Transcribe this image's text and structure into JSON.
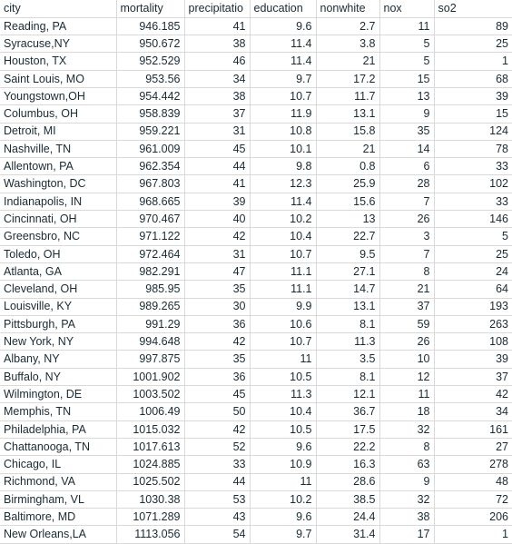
{
  "table": {
    "columns": [
      {
        "key": "city",
        "label": "city",
        "align": "left"
      },
      {
        "key": "mortality",
        "label": "mortality",
        "align": "right"
      },
      {
        "key": "precipitation",
        "label": "precipitatio",
        "align": "right"
      },
      {
        "key": "education",
        "label": "education",
        "align": "right"
      },
      {
        "key": "nonwhite",
        "label": "nonwhite",
        "align": "right"
      },
      {
        "key": "nox",
        "label": "nox",
        "align": "right"
      },
      {
        "key": "so2",
        "label": "so2",
        "align": "right"
      }
    ],
    "rows": [
      {
        "city": "Reading, PA",
        "mortality": "946.185",
        "precipitation": "41",
        "education": "9.6",
        "nonwhite": "2.7",
        "nox": "11",
        "so2": "89"
      },
      {
        "city": "Syracuse,NY",
        "mortality": "950.672",
        "precipitation": "38",
        "education": "11.4",
        "nonwhite": "3.8",
        "nox": "5",
        "so2": "25"
      },
      {
        "city": "Houston, TX",
        "mortality": "952.529",
        "precipitation": "46",
        "education": "11.4",
        "nonwhite": "21",
        "nox": "5",
        "so2": "1"
      },
      {
        "city": "Saint Louis, MO",
        "mortality": "953.56",
        "precipitation": "34",
        "education": "9.7",
        "nonwhite": "17.2",
        "nox": "15",
        "so2": "68"
      },
      {
        "city": "Youngstown,OH",
        "mortality": "954.442",
        "precipitation": "38",
        "education": "10.7",
        "nonwhite": "11.7",
        "nox": "13",
        "so2": "39"
      },
      {
        "city": "Columbus, OH",
        "mortality": "958.839",
        "precipitation": "37",
        "education": "11.9",
        "nonwhite": "13.1",
        "nox": "9",
        "so2": "15"
      },
      {
        "city": "Detroit, MI",
        "mortality": "959.221",
        "precipitation": "31",
        "education": "10.8",
        "nonwhite": "15.8",
        "nox": "35",
        "so2": "124"
      },
      {
        "city": "Nashville, TN",
        "mortality": "961.009",
        "precipitation": "45",
        "education": "10.1",
        "nonwhite": "21",
        "nox": "14",
        "so2": "78"
      },
      {
        "city": "Allentown, PA",
        "mortality": "962.354",
        "precipitation": "44",
        "education": "9.8",
        "nonwhite": "0.8",
        "nox": "6",
        "so2": "33"
      },
      {
        "city": "Washington, DC",
        "mortality": "967.803",
        "precipitation": "41",
        "education": "12.3",
        "nonwhite": "25.9",
        "nox": "28",
        "so2": "102"
      },
      {
        "city": "Indianapolis, IN",
        "mortality": "968.665",
        "precipitation": "39",
        "education": "11.4",
        "nonwhite": "15.6",
        "nox": "7",
        "so2": "33"
      },
      {
        "city": "Cincinnati, OH",
        "mortality": "970.467",
        "precipitation": "40",
        "education": "10.2",
        "nonwhite": "13",
        "nox": "26",
        "so2": "146"
      },
      {
        "city": "Greensbro, NC",
        "mortality": "971.122",
        "precipitation": "42",
        "education": "10.4",
        "nonwhite": "22.7",
        "nox": "3",
        "so2": "5"
      },
      {
        "city": "Toledo, OH",
        "mortality": "972.464",
        "precipitation": "31",
        "education": "10.7",
        "nonwhite": "9.5",
        "nox": "7",
        "so2": "25"
      },
      {
        "city": "Atlanta, GA",
        "mortality": "982.291",
        "precipitation": "47",
        "education": "11.1",
        "nonwhite": "27.1",
        "nox": "8",
        "so2": "24"
      },
      {
        "city": "Cleveland, OH",
        "mortality": "985.95",
        "precipitation": "35",
        "education": "11.1",
        "nonwhite": "14.7",
        "nox": "21",
        "so2": "64"
      },
      {
        "city": "Louisville, KY",
        "mortality": "989.265",
        "precipitation": "30",
        "education": "9.9",
        "nonwhite": "13.1",
        "nox": "37",
        "so2": "193"
      },
      {
        "city": "Pittsburgh, PA",
        "mortality": "991.29",
        "precipitation": "36",
        "education": "10.6",
        "nonwhite": "8.1",
        "nox": "59",
        "so2": "263"
      },
      {
        "city": "New York, NY",
        "mortality": "994.648",
        "precipitation": "42",
        "education": "10.7",
        "nonwhite": "11.3",
        "nox": "26",
        "so2": "108"
      },
      {
        "city": "Albany, NY",
        "mortality": "997.875",
        "precipitation": "35",
        "education": "11",
        "nonwhite": "3.5",
        "nox": "10",
        "so2": "39"
      },
      {
        "city": "Buffalo, NY",
        "mortality": "1001.902",
        "precipitation": "36",
        "education": "10.5",
        "nonwhite": "8.1",
        "nox": "12",
        "so2": "37"
      },
      {
        "city": "Wilmington, DE",
        "mortality": "1003.502",
        "precipitation": "45",
        "education": "11.3",
        "nonwhite": "12.1",
        "nox": "11",
        "so2": "42"
      },
      {
        "city": "Memphis, TN",
        "mortality": "1006.49",
        "precipitation": "50",
        "education": "10.4",
        "nonwhite": "36.7",
        "nox": "18",
        "so2": "34"
      },
      {
        "city": "Philadelphia, PA",
        "mortality": "1015.032",
        "precipitation": "42",
        "education": "10.5",
        "nonwhite": "17.5",
        "nox": "32",
        "so2": "161"
      },
      {
        "city": "Chattanooga, TN",
        "mortality": "1017.613",
        "precipitation": "52",
        "education": "9.6",
        "nonwhite": "22.2",
        "nox": "8",
        "so2": "27"
      },
      {
        "city": "Chicago, IL",
        "mortality": "1024.885",
        "precipitation": "33",
        "education": "10.9",
        "nonwhite": "16.3",
        "nox": "63",
        "so2": "278"
      },
      {
        "city": "Richmond, VA",
        "mortality": "1025.502",
        "precipitation": "44",
        "education": "11",
        "nonwhite": "28.6",
        "nox": "9",
        "so2": "48"
      },
      {
        "city": "Birmingham, VL",
        "mortality": "1030.38",
        "precipitation": "53",
        "education": "10.2",
        "nonwhite": "38.5",
        "nox": "32",
        "so2": "72"
      },
      {
        "city": "Baltimore, MD",
        "mortality": "1071.289",
        "precipitation": "43",
        "education": "9.6",
        "nonwhite": "24.4",
        "nox": "38",
        "so2": "206"
      },
      {
        "city": "New Orleans,LA",
        "mortality": "1113.056",
        "precipitation": "54",
        "education": "9.7",
        "nonwhite": "31.4",
        "nox": "17",
        "so2": "1"
      }
    ]
  },
  "colors": {
    "gridline": "#d9d9d9",
    "text": "#1a2a33",
    "background": "#ffffff"
  }
}
